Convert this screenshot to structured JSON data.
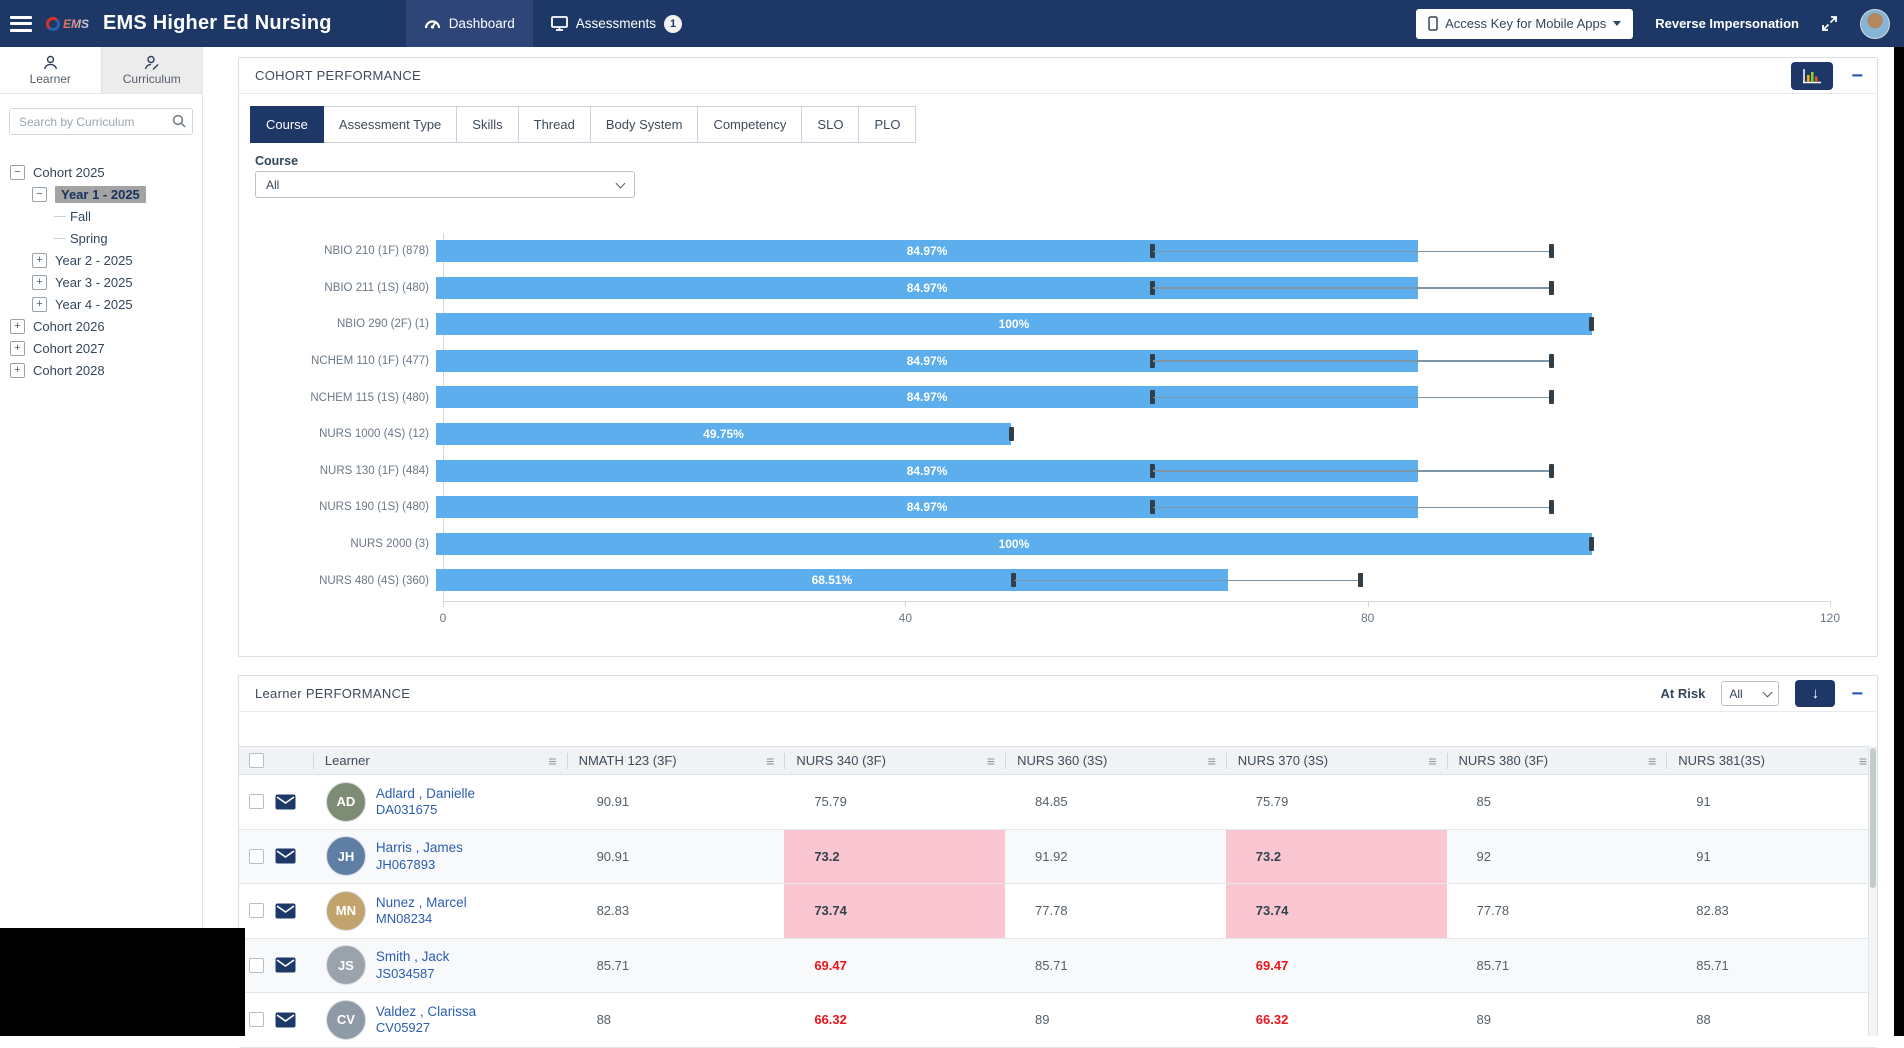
{
  "navbar": {
    "logo_text": "EMS",
    "title": "EMS Higher Ed Nursing",
    "dashboard_label": "Dashboard",
    "assessments_label": "Assessments",
    "assessments_badge": "1",
    "access_key_label": "Access Key for Mobile Apps",
    "reverse_impersonation_label": "Reverse Impersonation"
  },
  "sidebar": {
    "learner_tab": "Learner",
    "curriculum_tab": "Curriculum",
    "search_placeholder": "Search by Curriculum",
    "tree": [
      {
        "label": "Cohort 2025",
        "toggle": "minus",
        "level": 0,
        "selected": false
      },
      {
        "label": "Year 1 - 2025",
        "toggle": "minus",
        "level": 1,
        "selected": true
      },
      {
        "label": "Fall",
        "toggle": "none",
        "level": 2,
        "selected": false
      },
      {
        "label": "Spring",
        "toggle": "none",
        "level": 2,
        "selected": false
      },
      {
        "label": "Year 2 - 2025",
        "toggle": "plus",
        "level": 1,
        "selected": false
      },
      {
        "label": "Year 3 - 2025",
        "toggle": "plus",
        "level": 1,
        "selected": false
      },
      {
        "label": "Year 4 - 2025",
        "toggle": "plus",
        "level": 1,
        "selected": false
      },
      {
        "label": "Cohort 2026",
        "toggle": "plus",
        "level": 0,
        "selected": false
      },
      {
        "label": "Cohort 2027",
        "toggle": "plus",
        "level": 0,
        "selected": false
      },
      {
        "label": "Cohort 2028",
        "toggle": "plus",
        "level": 0,
        "selected": false
      }
    ]
  },
  "cohort_panel": {
    "title": "COHORT PERFORMANCE",
    "tabs": [
      "Course",
      "Assessment Type",
      "Skills",
      "Thread",
      "Body System",
      "Competency",
      "SLO",
      "PLO"
    ],
    "active_tab": "Course",
    "course_label": "Course",
    "course_value": "All"
  },
  "chart_data": {
    "type": "bar",
    "orientation": "horizontal",
    "categories": [
      "NBIO 210 (1F) (878)",
      "NBIO 211 (1S) (480)",
      "NBIO 290 (2F) (1)",
      "NCHEM 110 (1F) (477)",
      "NCHEM 115 (1S) (480)",
      "NURS 1000 (4S) (12)",
      "NURS 130 (1F) (484)",
      "NURS 190 (1S) (480)",
      "NURS 2000 (3)",
      "NURS 480 (4S) (360)"
    ],
    "values": [
      84.97,
      84.97,
      100,
      84.97,
      84.97,
      49.75,
      84.97,
      84.97,
      100,
      68.51
    ],
    "bar_labels": [
      "84.97%",
      "84.97%",
      "100%",
      "84.97%",
      "84.97%",
      "49.75%",
      "84.97%",
      "84.97%",
      "100%",
      "68.51%"
    ],
    "error_bars": [
      {
        "from": 62,
        "to": 96.5
      },
      {
        "from": 62,
        "to": 96.5
      },
      {
        "from": 100,
        "to": 100
      },
      {
        "from": 62,
        "to": 96.5
      },
      {
        "from": 62,
        "to": 96.5
      },
      {
        "from": 49.75,
        "to": 49.75
      },
      {
        "from": 62,
        "to": 96.5
      },
      {
        "from": 62,
        "to": 96.5
      },
      {
        "from": 100,
        "to": 100
      },
      {
        "from": 50,
        "to": 80
      }
    ],
    "xlim": [
      0,
      120
    ],
    "xticks": [
      0,
      40,
      80,
      120
    ],
    "bar_color": "#5caeec",
    "grid": false,
    "legend": false
  },
  "learner_panel": {
    "title": "Learner PERFORMANCE",
    "at_risk_label": "At Risk",
    "at_risk_value": "All",
    "columns": [
      "Learner",
      "NMATH 123 (3F)",
      "NURS 340 (3F)",
      "NURS 360 (3S)",
      "NURS 370 (3S)",
      "NURS 380 (3F)",
      "NURS 381(3S)"
    ],
    "highlight_colors": {
      "pink_bg": "#f9c6d2",
      "red_text": "#e9151b"
    },
    "rows": [
      {
        "name": "Adlard , Danielle",
        "id": "DA031675",
        "initials": "AD",
        "avatar_color": "#7d8c74",
        "scores": [
          {
            "v": "90.91"
          },
          {
            "v": "75.79"
          },
          {
            "v": "84.85"
          },
          {
            "v": "75.79"
          },
          {
            "v": "85"
          },
          {
            "v": "91"
          }
        ]
      },
      {
        "name": "Harris , James",
        "id": "JH067893",
        "initials": "JH",
        "avatar_color": "#5e7fa3",
        "scores": [
          {
            "v": "90.91"
          },
          {
            "v": "73.2",
            "hl": "pink"
          },
          {
            "v": "91.92"
          },
          {
            "v": "73.2",
            "hl": "pink"
          },
          {
            "v": "92"
          },
          {
            "v": "91"
          }
        ]
      },
      {
        "name": "Nunez , Marcel",
        "id": "MN08234",
        "initials": "MN",
        "avatar_color": "#c2a36b",
        "scores": [
          {
            "v": "82.83"
          },
          {
            "v": "73.74",
            "hl": "pink"
          },
          {
            "v": "77.78"
          },
          {
            "v": "73.74",
            "hl": "pink"
          },
          {
            "v": "77.78"
          },
          {
            "v": "82.83"
          }
        ]
      },
      {
        "name": "Smith , Jack",
        "id": "JS034587",
        "initials": "JS",
        "avatar_color": "#9aa3ab",
        "scores": [
          {
            "v": "85.71"
          },
          {
            "v": "69.47",
            "hl": "red"
          },
          {
            "v": "85.71"
          },
          {
            "v": "69.47",
            "hl": "red"
          },
          {
            "v": "85.71"
          },
          {
            "v": "85.71"
          }
        ]
      },
      {
        "name": "Valdez , Clarissa",
        "id": "CV05927",
        "initials": "CV",
        "avatar_color": "#8e9aa6",
        "scores": [
          {
            "v": "88"
          },
          {
            "v": "66.32",
            "hl": "red"
          },
          {
            "v": "89"
          },
          {
            "v": "66.32",
            "hl": "red"
          },
          {
            "v": "89"
          },
          {
            "v": "88"
          }
        ]
      }
    ]
  }
}
